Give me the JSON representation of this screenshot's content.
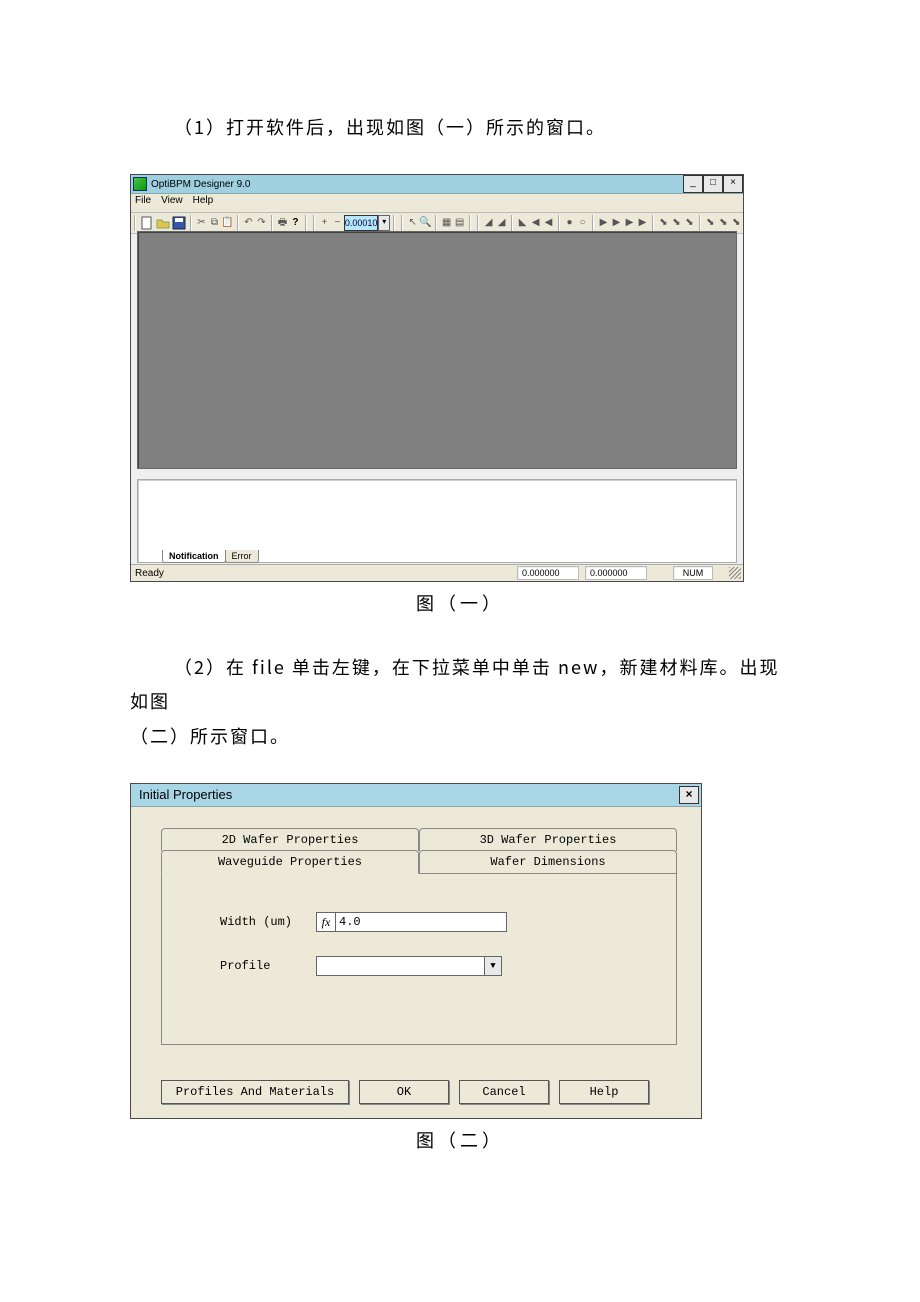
{
  "text": {
    "para1": "（1）打开软件后，出现如图（一）所示的窗口。",
    "caption1": "图（一）",
    "para2_a": "（2）在 file 单击左键，在下拉菜单中单击 new，新建材料库。出现如图",
    "para2_b": "（二）所示窗口。",
    "caption2": "图（二）"
  },
  "fig1": {
    "title": "OptiBPM Designer 9.0",
    "menubar": [
      "File",
      "View",
      "Help"
    ],
    "toolbar_number": "0.00010",
    "lower_tabs": {
      "active": "Notification",
      "other": "Error"
    },
    "status": {
      "ready": "Ready",
      "coord1": "0.000000",
      "coord2": "0.000000",
      "ind": "NUM"
    }
  },
  "fig2": {
    "title": "Initial Properties",
    "tabs_back": [
      "2D Wafer Properties",
      "3D Wafer Properties"
    ],
    "tabs_front": [
      "Waveguide Properties",
      "Wafer Dimensions"
    ],
    "tabs_front_active_index": 0,
    "fields": {
      "width_label": "Width (um)",
      "width_fx": "fx",
      "width_value": "4.0",
      "profile_label": "Profile"
    },
    "buttons": {
      "profiles": "Profiles And Materials",
      "ok": "OK",
      "cancel": "Cancel",
      "help": "Help"
    }
  }
}
